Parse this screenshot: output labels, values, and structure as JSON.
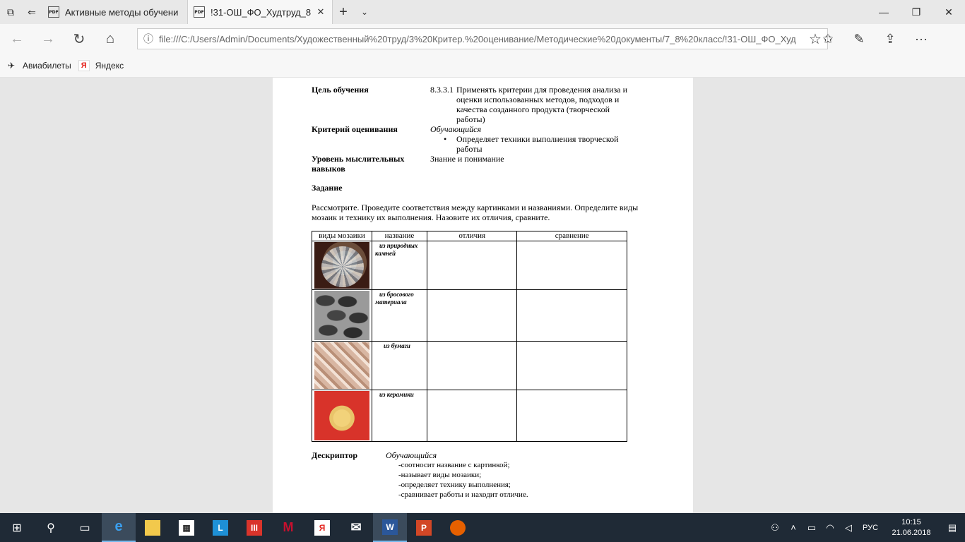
{
  "tabs": [
    {
      "title": "Активные методы обучени",
      "icon": "pdf-icon"
    },
    {
      "title": "!31-ОШ_ФО_Худтруд_8",
      "icon": "pdf-icon"
    }
  ],
  "address": {
    "url": "file:///C:/Users/Admin/Documents/Художественный%20труд/3%20Критер.%20оценивание/Методические%20документы/7_8%20класс/!31-ОШ_ФО_Худ"
  },
  "favorites": [
    {
      "label": "Авиабилеты",
      "icon": "airplane-icon"
    },
    {
      "label": "Яндекс",
      "icon": "yandex-icon"
    }
  ],
  "doc": {
    "goal_label": "Цель обучения",
    "goal_code": "8.3.3.1",
    "goal_lines": [
      "Применять критерии для проведения анализа и",
      "оценки использованных методов, подходов и",
      "качества созданного продукта (творческой",
      "работы)"
    ],
    "criteria_label": "Критерий оценивания",
    "criteria_head": "Обучающийся",
    "criteria_bullet_lines": [
      "Определяет техники выполнения творческой",
      "работы"
    ],
    "level_label_lines": [
      "Уровень мыслительных",
      "навыков"
    ],
    "level_value": "Знание и понимание",
    "task_label": "Задание",
    "task_lines": [
      "Рассмотрите. Проведите соответствия между картинками и названиями. Определите виды",
      "мозаик и технику их выполнения. Назовите их  отличия, сравните."
    ],
    "table": {
      "headers": [
        "виды мозаики",
        "название",
        "отличия",
        "сравнение"
      ],
      "rows": [
        {
          "name_lines": [
            "из природных",
            "камней"
          ]
        },
        {
          "name_lines": [
            "из бросового",
            "материала"
          ]
        },
        {
          "name_lines": [
            "из бумаги"
          ]
        },
        {
          "name_lines": [
            "из керамики"
          ]
        }
      ]
    },
    "descriptor_label": "Дескриптор",
    "descriptor_head": "Обучающийся",
    "descriptor_items": [
      "-соотносит название с картинкой;",
      "-называет виды мозаики;",
      "-определяет технику выполнения;",
      "-сравнивает работы и находит отличие."
    ]
  },
  "tray": {
    "lang": "РУС",
    "time": "10:15",
    "date": "21.06.2018"
  }
}
